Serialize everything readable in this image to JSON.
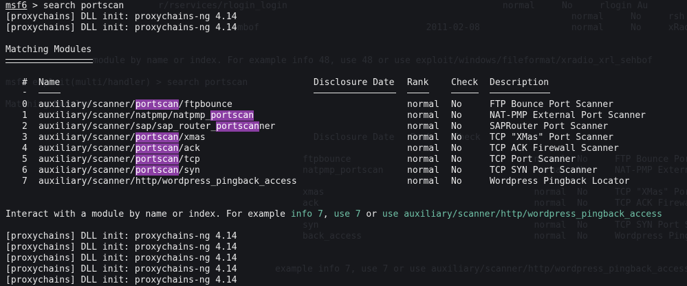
{
  "colors": {
    "background": "#17181c",
    "foreground": "#e8e8e8",
    "highlight": "#8a3ea3",
    "command_green": "#6fc0a6"
  },
  "prompt": {
    "name": "msf6",
    "command": " > search portscan"
  },
  "dll_top": [
    "[proxychains] DLL init: proxychains-ng 4.14",
    "[proxychains] DLL init: proxychains-ng 4.14"
  ],
  "matching_title": "Matching Modules",
  "table": {
    "headers": {
      "num": "#",
      "name": "Name",
      "disclosure": "Disclosure Date",
      "rank": "Rank",
      "check": "Check",
      "description": "Description"
    },
    "header_rule": "-",
    "rows": [
      {
        "num": "0",
        "pre": "auxiliary/scanner/",
        "hl": "portscan",
        "post": "/ftpbounce",
        "rank": "normal",
        "check": "No",
        "desc": "FTP Bounce Port Scanner"
      },
      {
        "num": "1",
        "pre": "auxiliary/scanner/natpmp/natpmp_",
        "hl": "portscan",
        "post": "",
        "rank": "normal",
        "check": "No",
        "desc": "NAT-PMP External Port Scanner"
      },
      {
        "num": "2",
        "pre": "auxiliary/scanner/sap/sap_router_",
        "hl": "portscan",
        "post": "ner",
        "rank": "normal",
        "check": "No",
        "desc": "SAPRouter Port Scanner"
      },
      {
        "num": "3",
        "pre": "auxiliary/scanner/",
        "hl": "portscan",
        "post": "/xmas",
        "rank": "normal",
        "check": "No",
        "desc": "TCP \"XMas\" Port Scanner"
      },
      {
        "num": "4",
        "pre": "auxiliary/scanner/",
        "hl": "portscan",
        "post": "/ack",
        "rank": "normal",
        "check": "No",
        "desc": "TCP ACK Firewall Scanner"
      },
      {
        "num": "5",
        "pre": "auxiliary/scanner/",
        "hl": "portscan",
        "post": "/tcp",
        "rank": "normal",
        "check": "No",
        "desc": "TCP Port Scanner"
      },
      {
        "num": "6",
        "pre": "auxiliary/scanner/",
        "hl": "portscan",
        "post": "/syn",
        "rank": "normal",
        "check": "No",
        "desc": "TCP SYN Port Scanner"
      },
      {
        "num": "7",
        "pre": "auxiliary/scanner/http/wordpress_pingback_access",
        "hl": "",
        "post": "",
        "rank": "normal",
        "check": "No",
        "desc": "Wordpress Pingback Locator"
      }
    ]
  },
  "interact": {
    "text1": "Interact with a module by name or index. For example ",
    "cmd1": "info 7",
    "sep1": ", ",
    "cmd2": "use 7",
    "sep2": " or ",
    "cmd3": "use auxiliary/scanner/http/wordpress_pingback_access"
  },
  "dll_bottom": [
    "[proxychains] DLL init: proxychains-ng 4.14",
    "[proxychains] DLL init: proxychains-ng 4.14",
    "[proxychains] DLL init: proxychains-ng 4.14",
    "[proxychains] DLL init: proxychains-ng 4.14",
    "[proxychains] DLL init: proxychains-ng 4.14"
  ],
  "ghost": {
    "line1": "r/rservices/rlogin_login                                        normal     No     rlogin Au",
    "line2": "n                                                               normal     No     rsh Authe",
    "line3": "sembof                               2011-02-08                 normal     No     xRadio 0.",
    "line4": "module by name or index. For example info 48, use 48 or use exploit/windows/fileformat/xradio_xrl_sehbof",
    "line5": "msf6 exploit(multi/handler) > search portscan",
    "line6": "Matching Modules",
    "line7": "Disclosure Date   Rank    Check",
    "line8": "ftpbounce                                  normal  No     FTP Bounce Port Scanner",
    "line9": "natpmp_portscan                            normal  No     NAT-PMP External Port Scanner",
    "line10": "xmas                                       normal  No     TCP \"XMas\" Port Scanner",
    "line11": "ack                                        normal  No     TCP ACK Firewall Scanner",
    "line12": "syn                                        normal  No     TCP SYN Port Scanner",
    "line13": "back_access                                normal  No     Wordpress Pingback Locator",
    "line14": "example info 7, use 7 or use auxiliary/scanner/http/wordpress_pingback_access"
  }
}
